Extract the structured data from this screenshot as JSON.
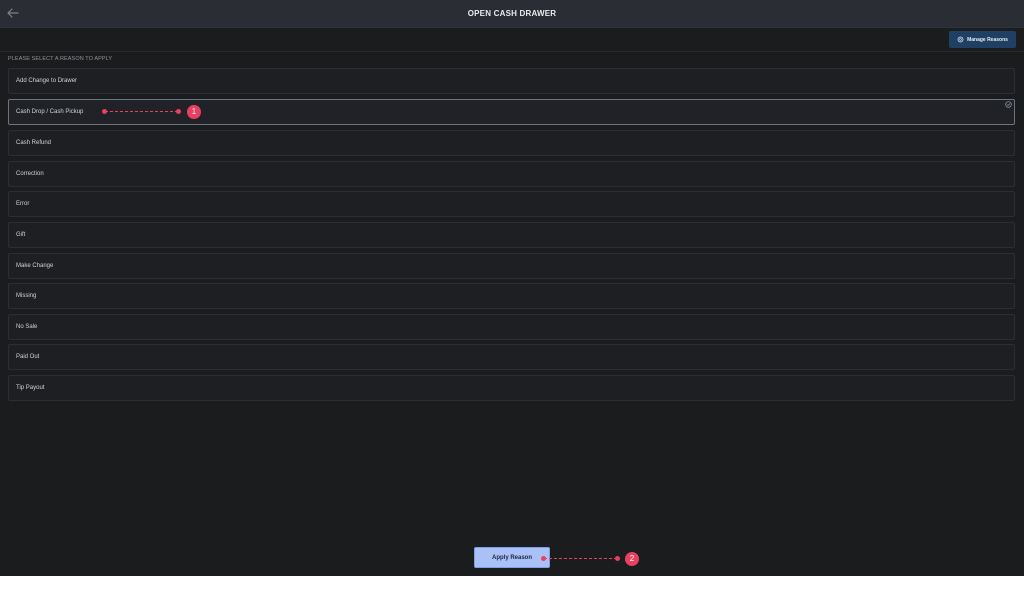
{
  "header": {
    "title": "OPEN CASH DRAWER",
    "back_icon": "arrow-left-icon"
  },
  "toolbar": {
    "manage_reasons_label": "Manage Reasons",
    "manage_reasons_icon": "gear-icon"
  },
  "section_label": "PLEASE SELECT A REASON TO APPLY",
  "reasons": [
    {
      "label": "Add Change to Drawer",
      "selected": false
    },
    {
      "label": "Cash Drop / Cash Pickup",
      "selected": true
    },
    {
      "label": "Cash Refund",
      "selected": false
    },
    {
      "label": "Correction",
      "selected": false
    },
    {
      "label": "Error",
      "selected": false
    },
    {
      "label": "Gift",
      "selected": false
    },
    {
      "label": "Make Change",
      "selected": false
    },
    {
      "label": "Missing",
      "selected": false
    },
    {
      "label": "No Sale",
      "selected": false
    },
    {
      "label": "Paid Out",
      "selected": false
    },
    {
      "label": "Tip Payout",
      "selected": false
    }
  ],
  "apply_button_label": "Apply Reason",
  "annotations": [
    {
      "number": "1"
    },
    {
      "number": "2"
    }
  ],
  "colors": {
    "background": "#1b1c1e",
    "header": "#2a2d33",
    "manage_button": "#1f3f63",
    "apply_button": "#a9c1f7",
    "annotation": "#e8405f"
  }
}
